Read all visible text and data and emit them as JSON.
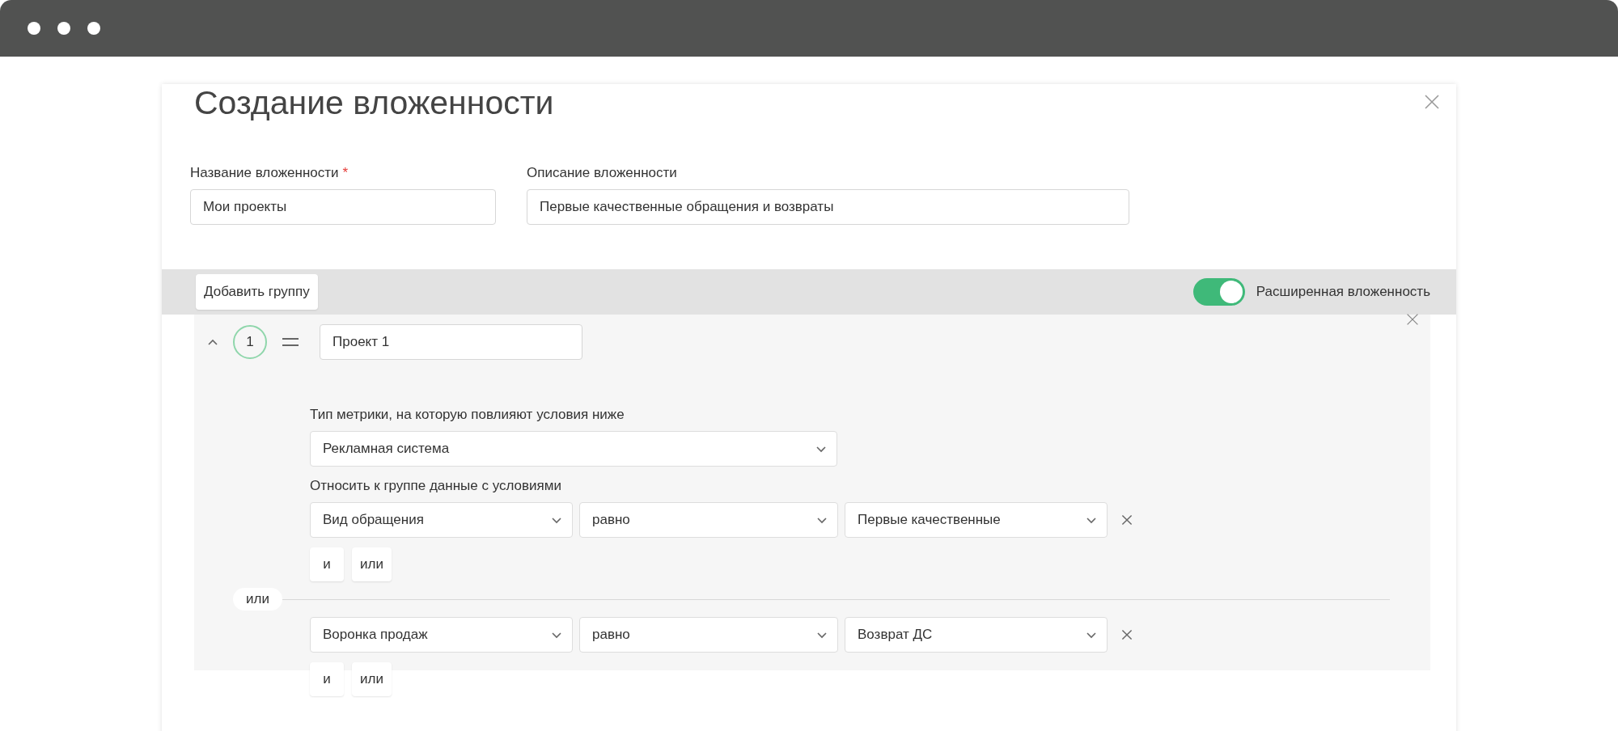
{
  "dialog": {
    "title": "Создание вложенности",
    "fields": [
      {
        "label": "Название вложенности",
        "required_mark": "*",
        "value": "Мои проекты"
      },
      {
        "label": "Описание вложенности",
        "value": "Первые качественные обращения и возвраты"
      }
    ],
    "toolbar": {
      "add_button": "Добавить группу",
      "toggle": {
        "label": "Расширенная вложенность",
        "on": true
      }
    },
    "groups": [
      {
        "number": "1",
        "expanded": true,
        "name": "Проект 1",
        "metric_label": "Тип метрики, на которую повлияют условия ниже",
        "metric_value": "Рекламная система",
        "conditions_label": "Относить к группе данные с условиями",
        "blocks": [
          {
            "conditions": [
              {
                "field": "Вид обращения",
                "operator": "равно",
                "value": "Первые качественные"
              }
            ],
            "and_label": "и",
            "or_label": "или"
          },
          {
            "separator": "или",
            "conditions": [
              {
                "field": "Воронка продаж",
                "operator": "равно",
                "value": "Возврат ДС"
              }
            ],
            "and_label": "и",
            "or_label": "или"
          }
        ]
      }
    ]
  }
}
